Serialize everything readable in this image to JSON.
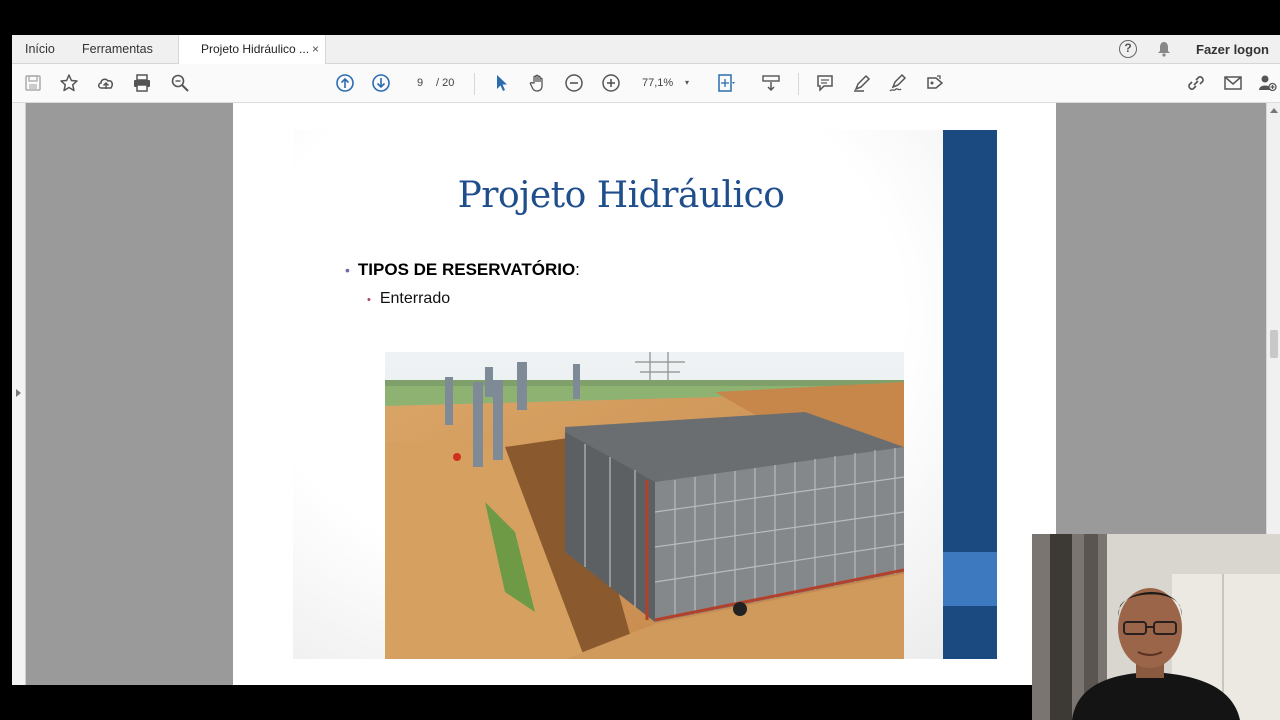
{
  "tabs": {
    "home": "Início",
    "tools": "Ferramentas",
    "document": "Projeto Hidráulico ...",
    "close": "×"
  },
  "header": {
    "logon": "Fazer logon"
  },
  "toolbar": {
    "page_current": "9",
    "page_total": "/ 20",
    "zoom": "77,1%",
    "zoom_caret": "▾"
  },
  "slide": {
    "title": "Projeto Hidráulico",
    "bullet1_bold": "TIPOS DE RESERVATÓRIO",
    "bullet1_suffix": ":",
    "bullet2": "Enterrado"
  },
  "colors": {
    "title_blue": "#1f4e8c",
    "sidebar_blue": "#1b4a80",
    "sidebar_accent": "#3d79bf"
  }
}
